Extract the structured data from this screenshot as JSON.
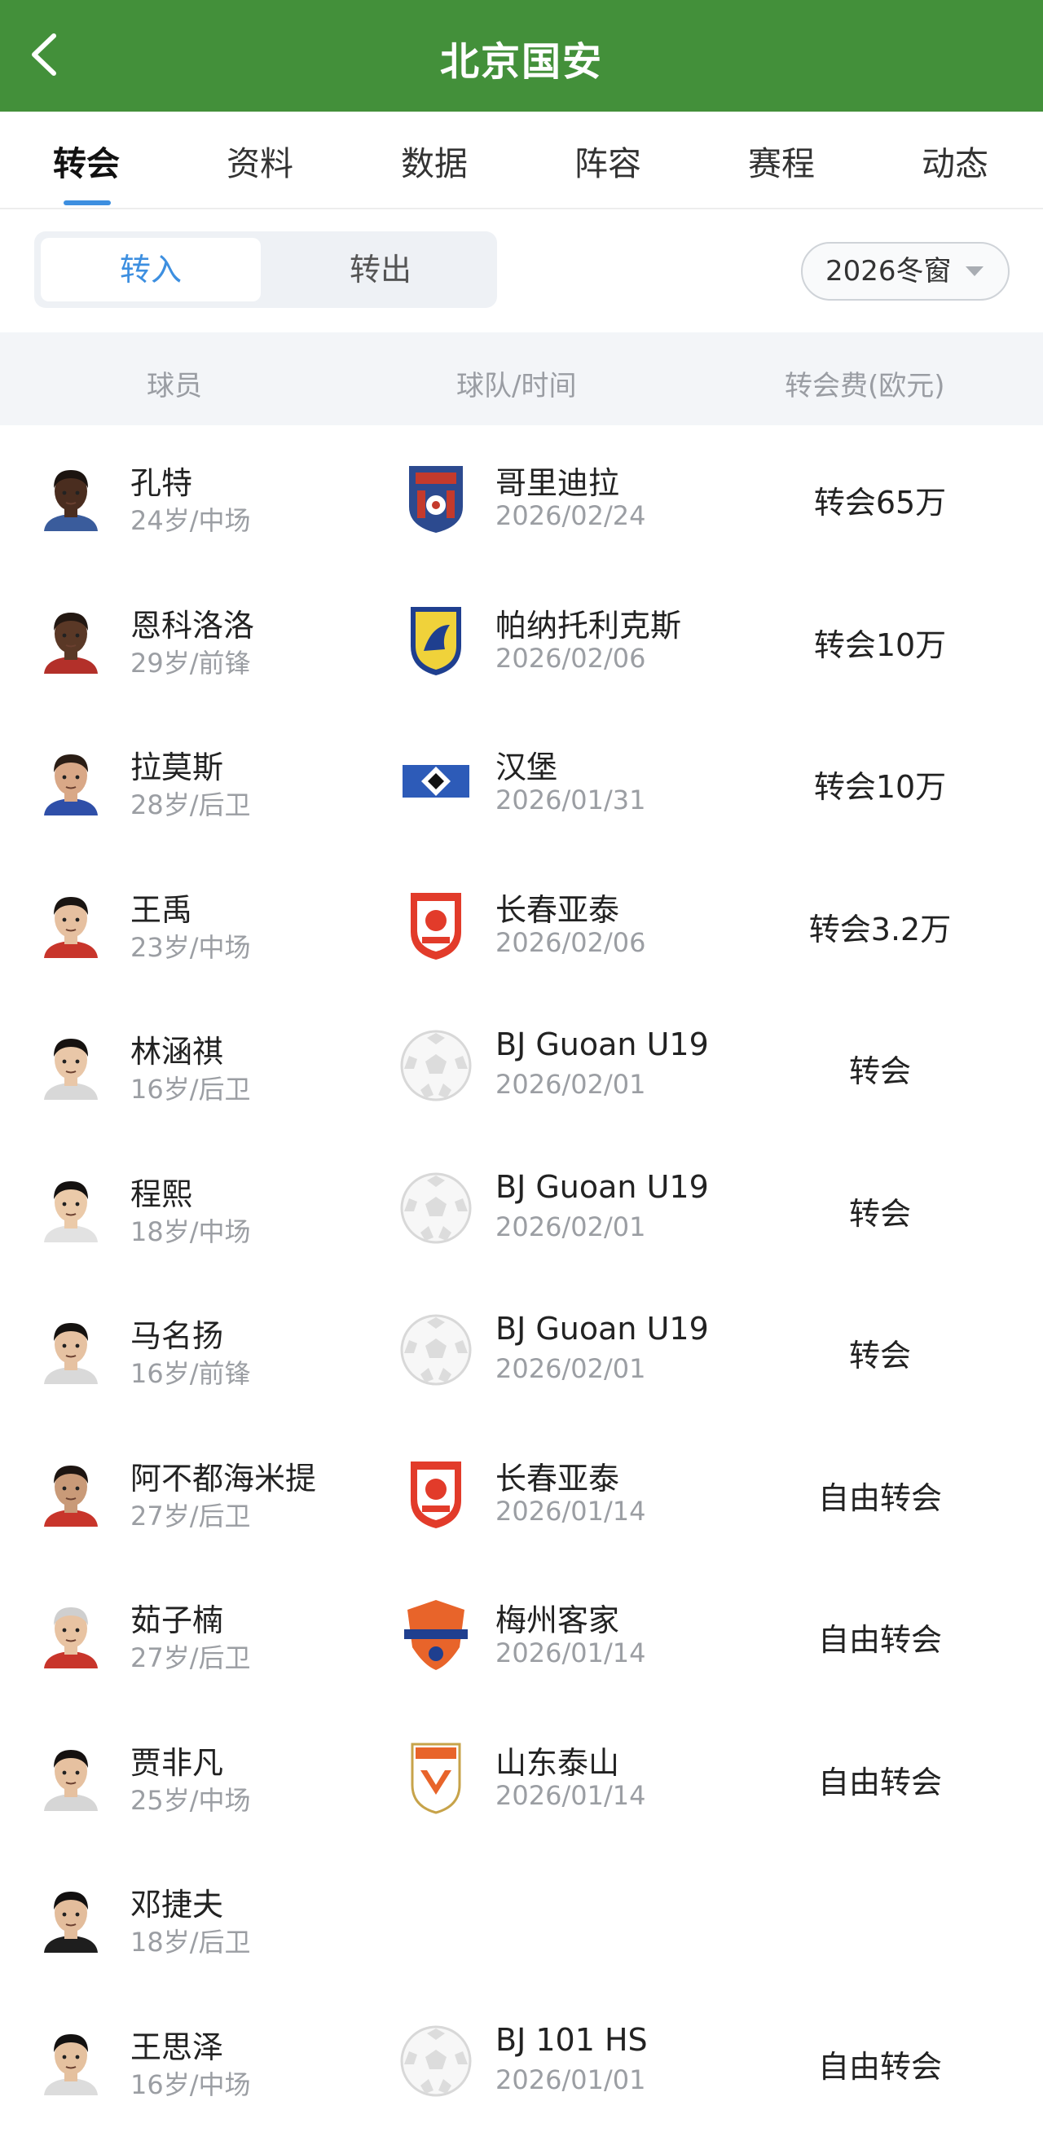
{
  "header": {
    "title": "北京国安"
  },
  "tabs": [
    {
      "label": "转会"
    },
    {
      "label": "资料"
    },
    {
      "label": "数据"
    },
    {
      "label": "阵容"
    },
    {
      "label": "赛程"
    },
    {
      "label": "动态"
    }
  ],
  "segment": {
    "in_label": "转入",
    "out_label": "转出"
  },
  "window_select": {
    "value": "2026冬窗"
  },
  "table": {
    "headers": {
      "player": "球员",
      "team_date": "球队/时间",
      "fee": "转会费(欧元)"
    },
    "rows": [
      {
        "name": "孔特",
        "info": "24岁/中场",
        "team": "哥里迪拉",
        "date": "2026/02/24",
        "fee": "转会65万",
        "logo": "fc-dila-crest",
        "skin": "#4a2d1f",
        "hair": "#1c1410",
        "shirt": "#3a5c9c"
      },
      {
        "name": "恩科洛洛",
        "info": "29岁/前锋",
        "team": "帕纳托利克斯",
        "date": "2026/02/06",
        "fee": "转会10万",
        "logo": "panetolikos-crest",
        "skin": "#5a3826",
        "hair": "#231812",
        "shirt": "#b3302a"
      },
      {
        "name": "拉莫斯",
        "info": "28岁/后卫",
        "team": "汉堡",
        "date": "2026/01/31",
        "fee": "转会10万",
        "logo": "hamburg-diamond",
        "skin": "#d9a887",
        "hair": "#2a1d15",
        "shirt": "#2f4fa8"
      },
      {
        "name": "王禹",
        "info": "23岁/中场",
        "team": "长春亚泰",
        "date": "2026/02/06",
        "fee": "转会3.2万",
        "logo": "changchun-yatai-crest",
        "skin": "#e6c0a0",
        "hair": "#1a1512",
        "shirt": "#c8352b"
      },
      {
        "name": "林涵祺",
        "info": "16岁/后卫",
        "team": "BJ Guoan U19",
        "date": "2026/02/01",
        "fee": "转会",
        "logo": "football-placeholder",
        "skin": "#e9c7a8",
        "hair": "#161210",
        "shirt": "#d8d8d8"
      },
      {
        "name": "程熙",
        "info": "18岁/中场",
        "team": "BJ Guoan U19",
        "date": "2026/02/01",
        "fee": "转会",
        "logo": "football-placeholder",
        "skin": "#ebcaa9",
        "hair": "#141110",
        "shirt": "#e2e2e2"
      },
      {
        "name": "马名扬",
        "info": "16岁/前锋",
        "team": "BJ Guoan U19",
        "date": "2026/02/01",
        "fee": "转会",
        "logo": "football-placeholder",
        "skin": "#e6c2a2",
        "hair": "#151210",
        "shirt": "#d9d9d9"
      },
      {
        "name": "阿不都海米提",
        "info": "27岁/后卫",
        "team": "长春亚泰",
        "date": "2026/01/14",
        "fee": "自由转会",
        "logo": "changchun-yatai-crest",
        "skin": "#c99a78",
        "hair": "#1d1511",
        "shirt": "#c8352b"
      },
      {
        "name": "茹子楠",
        "info": "27岁/后卫",
        "team": "梅州客家",
        "date": "2026/01/14",
        "fee": "自由转会",
        "logo": "meizhou-hakka-crest",
        "skin": "#e8c3a2",
        "hair": "#cfcfcf",
        "shirt": "#c8352b"
      },
      {
        "name": "贾非凡",
        "info": "25岁/中场",
        "team": "山东泰山",
        "date": "2026/01/14",
        "fee": "自由转会",
        "logo": "shandong-taishan-crest",
        "skin": "#e6c1a0",
        "hair": "#151110",
        "shirt": "#d6d6d6"
      },
      {
        "name": "邓捷夫",
        "info": "18岁/后卫",
        "team": "",
        "date": "",
        "fee": "",
        "logo": "",
        "skin": "#e3bd9c",
        "hair": "#121010",
        "shirt": "#1e1e1e"
      },
      {
        "name": "王思泽",
        "info": "16岁/中场",
        "team": "BJ 101 HS",
        "date": "2026/01/01",
        "fee": "自由转会",
        "logo": "football-placeholder",
        "skin": "#e5c19f",
        "hair": "#131110",
        "shirt": "#dcdcdc"
      }
    ]
  }
}
